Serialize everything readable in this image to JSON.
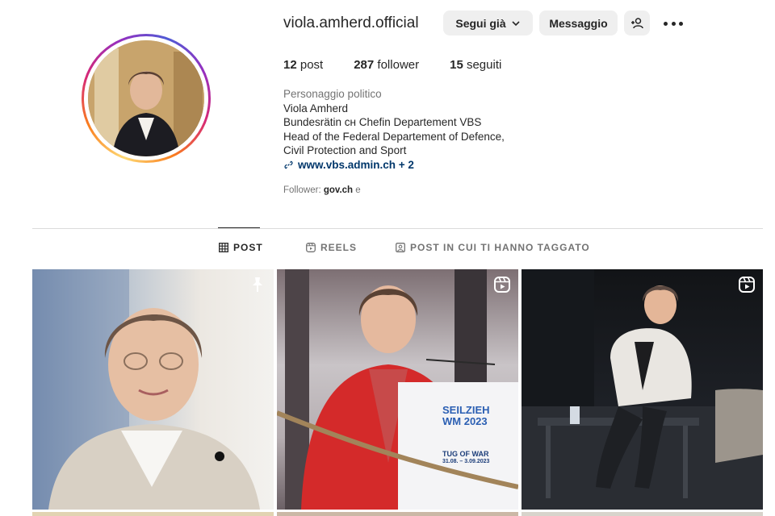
{
  "profile": {
    "username": "viola.amherd.official",
    "avatar_icon": "profile-photo"
  },
  "actions": {
    "follow_label": "Segui già",
    "message_label": "Messaggio",
    "add_user_icon": "person-plus-icon",
    "more_icon": "ellipsis-icon"
  },
  "stats": {
    "posts_count": "12",
    "posts_label": "post",
    "followers_count": "287",
    "followers_label": "follower",
    "following_count": "15",
    "following_label": "seguiti"
  },
  "bio": {
    "category": "Personaggio politico",
    "name": "Viola Amherd",
    "line1": "Bundesrätin ᴄʜ Chefin Departement VBS",
    "line2": "Head of the Federal Departement of Defence,",
    "line3": "Civil Protection and Sport",
    "link": "www.vbs.admin.ch + 2",
    "followed_by_prefix": "Follower:",
    "followed_by_account": "gov.ch",
    "followed_by_suffix": "e"
  },
  "tabs": [
    {
      "label": "POST",
      "icon": "grid-icon",
      "active": true
    },
    {
      "label": "REELS",
      "icon": "reels-icon",
      "active": false
    },
    {
      "label": "POST IN CUI TI HANNO TAGGATO",
      "icon": "tagged-icon",
      "active": false
    }
  ],
  "grid": [
    {
      "type": "pinned-post",
      "badge_icon": "pin-icon"
    },
    {
      "type": "reel",
      "badge_icon": "reels-icon",
      "sign_text": [
        "SEILZIEH",
        "WM 2023",
        "TUG OF WAR",
        "31.08. – 3.09.2023"
      ]
    },
    {
      "type": "reel",
      "badge_icon": "reels-icon"
    }
  ],
  "colors": {
    "text": "#262626",
    "muted": "#737373",
    "link": "#00376b",
    "button_bg": "#efefef",
    "divider": "#dbdbdb"
  }
}
